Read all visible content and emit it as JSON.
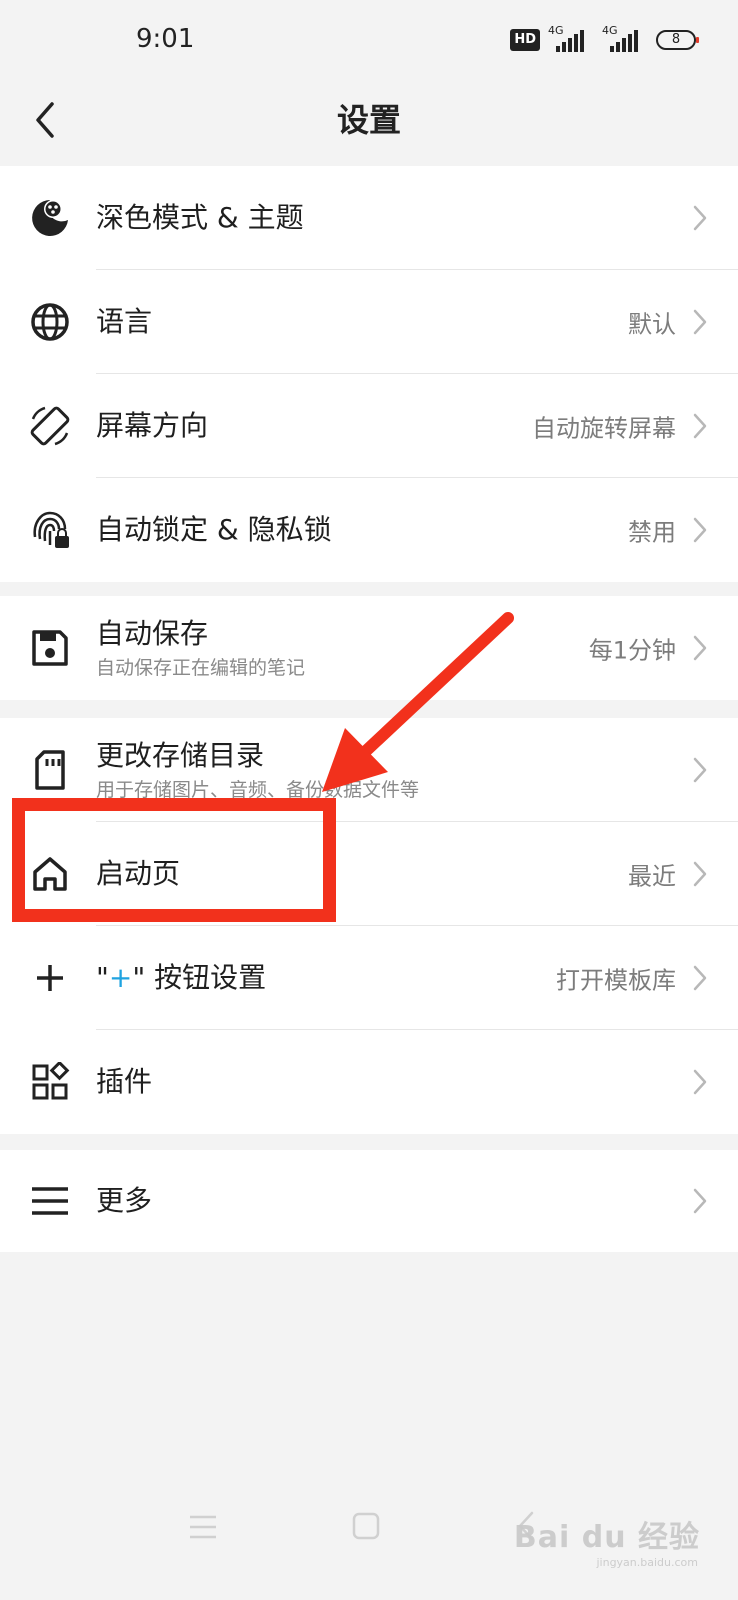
{
  "status": {
    "time": "9:01",
    "hd": "HD",
    "net1": "4G",
    "net2": "4G",
    "battery": "8"
  },
  "header": {
    "title": "设置"
  },
  "groups": [
    {
      "items": [
        {
          "label": "深色模式 & 主题",
          "value": "",
          "icon": "palette-moon-icon"
        },
        {
          "label": "语言",
          "value": "默认",
          "icon": "globe-icon"
        },
        {
          "label": "屏幕方向",
          "value": "自动旋转屏幕",
          "icon": "screen-rotation-icon"
        },
        {
          "label": "自动锁定 & 隐私锁",
          "value": "禁用",
          "icon": "fingerprint-lock-icon"
        }
      ]
    },
    {
      "items": [
        {
          "label": "自动保存",
          "sub": "自动保存正在编辑的笔记",
          "value": "每1分钟",
          "icon": "save-icon"
        }
      ]
    },
    {
      "items": [
        {
          "label": "更改存储目录",
          "sub": "用于存储图片、音频、备份数据文件等",
          "value": "",
          "icon": "sd-card-icon"
        },
        {
          "label": "启动页",
          "value": "最近",
          "icon": "home-icon"
        },
        {
          "label_prefix": "\"",
          "label_plus": "+",
          "label_suffix": "\" 按钮设置",
          "value": "打开模板库",
          "icon": "plus-icon"
        },
        {
          "label": "插件",
          "value": "",
          "icon": "widgets-icon"
        }
      ]
    },
    {
      "items": [
        {
          "label": "更多",
          "value": "",
          "icon": "menu-icon"
        }
      ]
    }
  ],
  "watermark": {
    "text": "Bai du 经验",
    "sub": "jingyan.baidu.com"
  },
  "colors": {
    "annotation": "#f2311c",
    "accent": "#1fa3e0"
  }
}
